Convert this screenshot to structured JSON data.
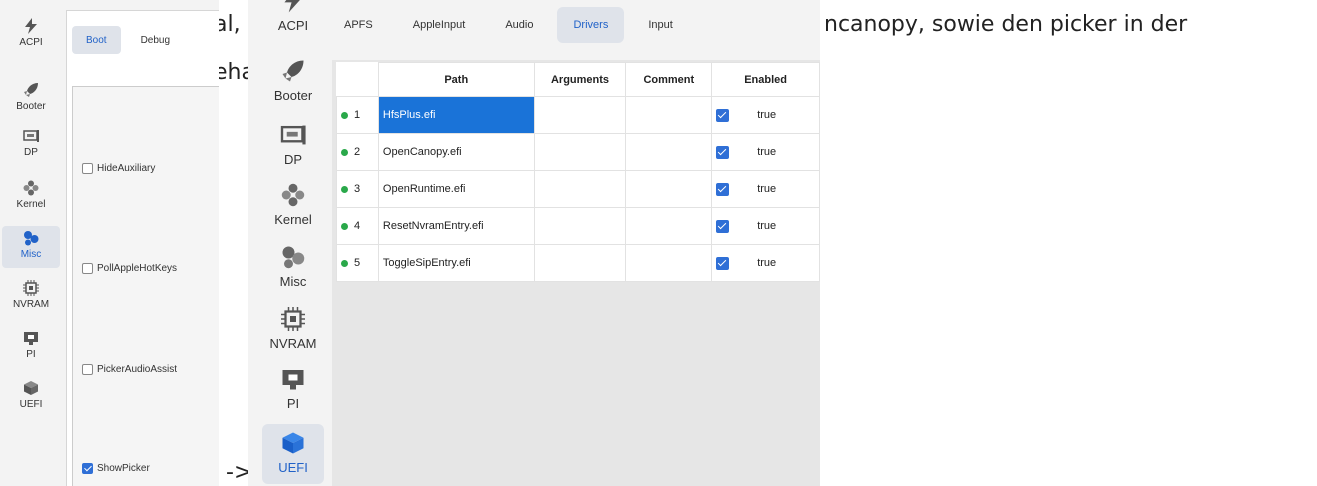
{
  "prose": {
    "line1": "al,",
    "line2": "eha",
    "line3": "ncanopy, sowie den picker in der",
    "arrow": "->"
  },
  "shot1": {
    "rail": [
      {
        "label": "ACPI",
        "icon": "lightning-icon"
      },
      {
        "label": "Booter",
        "icon": "rocket-icon"
      },
      {
        "label": "DP",
        "icon": "device-icon"
      },
      {
        "label": "Kernel",
        "icon": "puzzle-icon"
      },
      {
        "label": "Misc",
        "icon": "cog-blob-icon",
        "active": true
      },
      {
        "label": "NVRAM",
        "icon": "chip-icon"
      },
      {
        "label": "PI",
        "icon": "monitor-icon"
      },
      {
        "label": "UEFI",
        "icon": "cube-icon"
      }
    ],
    "tabs": [
      {
        "label": "Boot",
        "active": true
      },
      {
        "label": "Debug"
      }
    ],
    "checks": [
      {
        "label": "HideAuxiliary",
        "checked": false
      },
      {
        "label": "PollAppleHotKeys",
        "checked": false
      },
      {
        "label": "PickerAudioAssist",
        "checked": false
      },
      {
        "label": "ShowPicker",
        "checked": true
      }
    ]
  },
  "shot2": {
    "items": [
      {
        "label": "ACPI",
        "icon": "lightning-icon"
      },
      {
        "label": "Booter",
        "icon": "rocket-icon"
      },
      {
        "label": "DP",
        "icon": "device-icon"
      },
      {
        "label": "Kernel",
        "icon": "puzzle-icon"
      },
      {
        "label": "Misc",
        "icon": "cog-blob-icon"
      },
      {
        "label": "NVRAM",
        "icon": "chip-icon"
      },
      {
        "label": "PI",
        "icon": "monitor-icon"
      },
      {
        "label": "UEFI",
        "icon": "cube-icon",
        "active": true
      }
    ]
  },
  "shot3": {
    "tabs": [
      {
        "label": "APFS"
      },
      {
        "label": "AppleInput"
      },
      {
        "label": "Audio"
      },
      {
        "label": "Drivers",
        "active": true
      },
      {
        "label": "Input"
      }
    ],
    "columns": [
      "Path",
      "Arguments",
      "Comment",
      "Enabled"
    ],
    "rows": [
      {
        "n": "1",
        "path": "HfsPlus.efi",
        "args": "",
        "comment": "",
        "enabled": "true",
        "selected": true
      },
      {
        "n": "2",
        "path": "OpenCanopy.efi",
        "args": "",
        "comment": "",
        "enabled": "true"
      },
      {
        "n": "3",
        "path": "OpenRuntime.efi",
        "args": "",
        "comment": "",
        "enabled": "true"
      },
      {
        "n": "4",
        "path": "ResetNvramEntry.efi",
        "args": "",
        "comment": "",
        "enabled": "true"
      },
      {
        "n": "5",
        "path": "ToggleSipEntry.efi",
        "args": "",
        "comment": "",
        "enabled": "true"
      }
    ]
  },
  "colors": {
    "accent": "#2162c8",
    "selection": "#1a73d8",
    "status_dot": "#2aa84a"
  }
}
